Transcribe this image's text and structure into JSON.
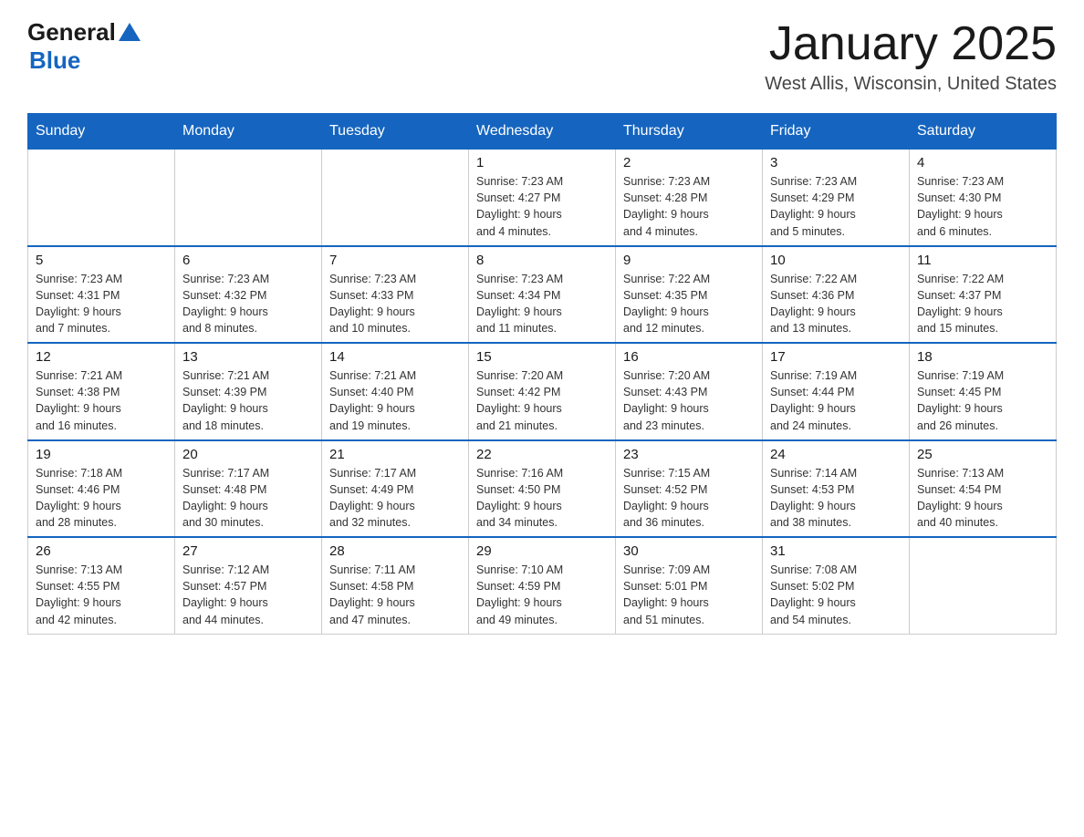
{
  "header": {
    "month_title": "January 2025",
    "location": "West Allis, Wisconsin, United States",
    "logo_general": "General",
    "logo_blue": "Blue"
  },
  "days_of_week": [
    "Sunday",
    "Monday",
    "Tuesday",
    "Wednesday",
    "Thursday",
    "Friday",
    "Saturday"
  ],
  "weeks": [
    {
      "cells": [
        {
          "day": "",
          "info": ""
        },
        {
          "day": "",
          "info": ""
        },
        {
          "day": "",
          "info": ""
        },
        {
          "day": "1",
          "info": "Sunrise: 7:23 AM\nSunset: 4:27 PM\nDaylight: 9 hours\nand 4 minutes."
        },
        {
          "day": "2",
          "info": "Sunrise: 7:23 AM\nSunset: 4:28 PM\nDaylight: 9 hours\nand 4 minutes."
        },
        {
          "day": "3",
          "info": "Sunrise: 7:23 AM\nSunset: 4:29 PM\nDaylight: 9 hours\nand 5 minutes."
        },
        {
          "day": "4",
          "info": "Sunrise: 7:23 AM\nSunset: 4:30 PM\nDaylight: 9 hours\nand 6 minutes."
        }
      ]
    },
    {
      "cells": [
        {
          "day": "5",
          "info": "Sunrise: 7:23 AM\nSunset: 4:31 PM\nDaylight: 9 hours\nand 7 minutes."
        },
        {
          "day": "6",
          "info": "Sunrise: 7:23 AM\nSunset: 4:32 PM\nDaylight: 9 hours\nand 8 minutes."
        },
        {
          "day": "7",
          "info": "Sunrise: 7:23 AM\nSunset: 4:33 PM\nDaylight: 9 hours\nand 10 minutes."
        },
        {
          "day": "8",
          "info": "Sunrise: 7:23 AM\nSunset: 4:34 PM\nDaylight: 9 hours\nand 11 minutes."
        },
        {
          "day": "9",
          "info": "Sunrise: 7:22 AM\nSunset: 4:35 PM\nDaylight: 9 hours\nand 12 minutes."
        },
        {
          "day": "10",
          "info": "Sunrise: 7:22 AM\nSunset: 4:36 PM\nDaylight: 9 hours\nand 13 minutes."
        },
        {
          "day": "11",
          "info": "Sunrise: 7:22 AM\nSunset: 4:37 PM\nDaylight: 9 hours\nand 15 minutes."
        }
      ]
    },
    {
      "cells": [
        {
          "day": "12",
          "info": "Sunrise: 7:21 AM\nSunset: 4:38 PM\nDaylight: 9 hours\nand 16 minutes."
        },
        {
          "day": "13",
          "info": "Sunrise: 7:21 AM\nSunset: 4:39 PM\nDaylight: 9 hours\nand 18 minutes."
        },
        {
          "day": "14",
          "info": "Sunrise: 7:21 AM\nSunset: 4:40 PM\nDaylight: 9 hours\nand 19 minutes."
        },
        {
          "day": "15",
          "info": "Sunrise: 7:20 AM\nSunset: 4:42 PM\nDaylight: 9 hours\nand 21 minutes."
        },
        {
          "day": "16",
          "info": "Sunrise: 7:20 AM\nSunset: 4:43 PM\nDaylight: 9 hours\nand 23 minutes."
        },
        {
          "day": "17",
          "info": "Sunrise: 7:19 AM\nSunset: 4:44 PM\nDaylight: 9 hours\nand 24 minutes."
        },
        {
          "day": "18",
          "info": "Sunrise: 7:19 AM\nSunset: 4:45 PM\nDaylight: 9 hours\nand 26 minutes."
        }
      ]
    },
    {
      "cells": [
        {
          "day": "19",
          "info": "Sunrise: 7:18 AM\nSunset: 4:46 PM\nDaylight: 9 hours\nand 28 minutes."
        },
        {
          "day": "20",
          "info": "Sunrise: 7:17 AM\nSunset: 4:48 PM\nDaylight: 9 hours\nand 30 minutes."
        },
        {
          "day": "21",
          "info": "Sunrise: 7:17 AM\nSunset: 4:49 PM\nDaylight: 9 hours\nand 32 minutes."
        },
        {
          "day": "22",
          "info": "Sunrise: 7:16 AM\nSunset: 4:50 PM\nDaylight: 9 hours\nand 34 minutes."
        },
        {
          "day": "23",
          "info": "Sunrise: 7:15 AM\nSunset: 4:52 PM\nDaylight: 9 hours\nand 36 minutes."
        },
        {
          "day": "24",
          "info": "Sunrise: 7:14 AM\nSunset: 4:53 PM\nDaylight: 9 hours\nand 38 minutes."
        },
        {
          "day": "25",
          "info": "Sunrise: 7:13 AM\nSunset: 4:54 PM\nDaylight: 9 hours\nand 40 minutes."
        }
      ]
    },
    {
      "cells": [
        {
          "day": "26",
          "info": "Sunrise: 7:13 AM\nSunset: 4:55 PM\nDaylight: 9 hours\nand 42 minutes."
        },
        {
          "day": "27",
          "info": "Sunrise: 7:12 AM\nSunset: 4:57 PM\nDaylight: 9 hours\nand 44 minutes."
        },
        {
          "day": "28",
          "info": "Sunrise: 7:11 AM\nSunset: 4:58 PM\nDaylight: 9 hours\nand 47 minutes."
        },
        {
          "day": "29",
          "info": "Sunrise: 7:10 AM\nSunset: 4:59 PM\nDaylight: 9 hours\nand 49 minutes."
        },
        {
          "day": "30",
          "info": "Sunrise: 7:09 AM\nSunset: 5:01 PM\nDaylight: 9 hours\nand 51 minutes."
        },
        {
          "day": "31",
          "info": "Sunrise: 7:08 AM\nSunset: 5:02 PM\nDaylight: 9 hours\nand 54 minutes."
        },
        {
          "day": "",
          "info": ""
        }
      ]
    }
  ]
}
